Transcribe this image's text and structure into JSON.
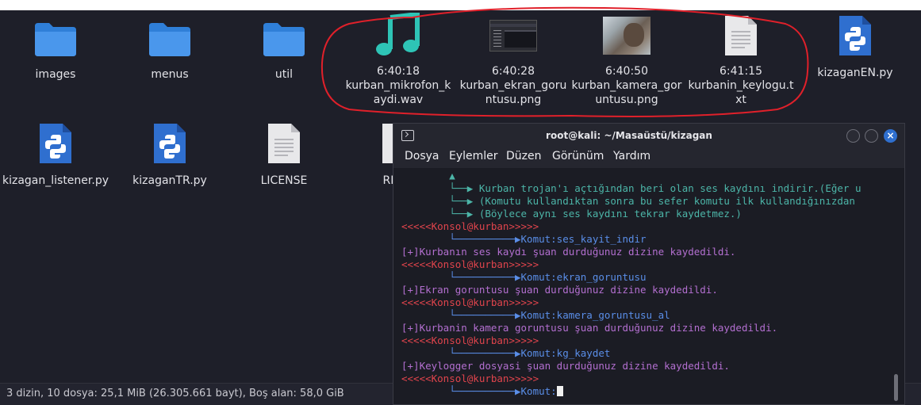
{
  "files": [
    {
      "name": "images",
      "type": "folder"
    },
    {
      "name": "menus",
      "type": "folder"
    },
    {
      "name": "util",
      "type": "folder"
    },
    {
      "name": "kurban_mikrofon_kaydi.wav",
      "time": "6:40:18",
      "type": "audio"
    },
    {
      "name": "kurban_ekran_goruntusu.png",
      "time": "6:40:28",
      "type": "image-screen"
    },
    {
      "name": "kurban_kamera_goruntusu.png",
      "time": "6:40:50",
      "type": "image-camera"
    },
    {
      "name": "kurbanin_keylogu.txt",
      "time": "6:41:15",
      "type": "text"
    },
    {
      "name": "kizaganEN.py",
      "type": "python"
    },
    {
      "name": "kizagan_listener.py",
      "type": "python"
    },
    {
      "name": "kizaganTR.py",
      "type": "python"
    },
    {
      "name": "LICENSE",
      "type": "text"
    },
    {
      "name": "READ",
      "type": "text-partial"
    }
  ],
  "status_bar": "3 dizin, 10 dosya: 25,1 MiB (26.305.661 bayt), Boş alan: 58,0 GiB",
  "terminal": {
    "title": "root@kali: ~/Masaüstü/kizagan",
    "menu": [
      "Dosya",
      "Eylemler",
      "Düzen",
      "Görünüm",
      "Yardım"
    ],
    "close_glyph": "×",
    "lines": [
      {
        "text": "        ▲",
        "color": "teal"
      },
      {
        "text": "        └──▶ Kurban trojan'ı açtığından beri olan ses kaydını indirir.(Eğer u",
        "color": "teal"
      },
      {
        "text": "        └──▶ (Komutu kullandıktan sonra bu sefer komutu ilk kullandığınızdan",
        "color": "teal"
      },
      {
        "text": "        └──▶ (Böylece aynı ses kaydını tekrar kaydetmez.)",
        "color": "teal"
      },
      {
        "text": "<<<<<Konsol@kurban>>>>>",
        "color": "red"
      },
      {
        "text": "        └──────────▶Komut:ses_kayit_indir",
        "color": "blue"
      },
      {
        "text": "[+]Kurbanın ses kaydı şuan durduğunuz dizine kaydedildi.",
        "color": "purple"
      },
      {
        "text": "<<<<<Konsol@kurban>>>>>",
        "color": "red"
      },
      {
        "text": "        └──────────▶Komut:ekran_goruntusu",
        "color": "blue"
      },
      {
        "text": "[+]Ekran goruntusu şuan durduğunuz dizine kaydedildi.",
        "color": "purple"
      },
      {
        "text": "<<<<<Konsol@kurban>>>>>",
        "color": "red"
      },
      {
        "text": "        └──────────▶Komut:kamera_goruntusu_al",
        "color": "blue"
      },
      {
        "text": "[+]Kurbanin kamera goruntusu şuan durduğunuz dizine kaydedildi.",
        "color": "purple"
      },
      {
        "text": "<<<<<Konsol@kurban>>>>>",
        "color": "red"
      },
      {
        "text": "        └──────────▶Komut:kg_kaydet",
        "color": "blue"
      },
      {
        "text": "[+]Keylogger dosyasi şuan durduğunuz dizine kaydedildi.",
        "color": "purple"
      },
      {
        "text": "<<<<<Konsol@kurban>>>>>",
        "color": "red"
      },
      {
        "text": "        └──────────▶Komut:",
        "color": "blue"
      }
    ]
  },
  "colors": {
    "folder": "#3d8fe6",
    "audio": "#2ec4b6",
    "python": "#2f6fcf",
    "annotation": "#e0202a"
  }
}
